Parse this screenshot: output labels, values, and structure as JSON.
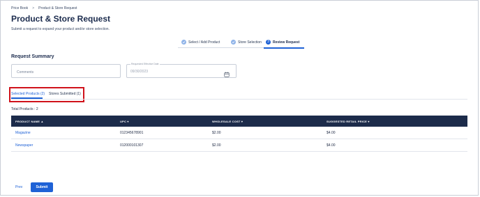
{
  "breadcrumb": {
    "items": [
      "Price Book",
      "Product & Store Request"
    ],
    "separator": ">"
  },
  "page": {
    "title": "Product & Store Request",
    "subtitle": "Submit a request to expand your product and/or store selection."
  },
  "stepper": {
    "steps": [
      {
        "label": "Select / Add Product",
        "state": "done",
        "marker": ""
      },
      {
        "label": "Store Selection",
        "state": "done",
        "marker": ""
      },
      {
        "label": "Review Request",
        "state": "active",
        "marker": "3"
      }
    ]
  },
  "request_summary": {
    "title": "Request Summary",
    "comments_placeholder": "Comments",
    "date_label": "Requested Effective Date",
    "date_value": "09/30/2023"
  },
  "tabs": [
    {
      "label": "Selected Products (2)",
      "selected": true
    },
    {
      "label": "Stores Submitted (1)",
      "selected": false
    }
  ],
  "total_products": "Total Products : 2",
  "table": {
    "columns": [
      "PRODUCT NAME ▲",
      "UPC ▾",
      "WHOLESALE COST ▾",
      "SUGGESTED RETAIL PRICE ▾"
    ],
    "rows": [
      [
        "Magazine",
        "012345678901",
        "$2.00",
        "$4.00"
      ],
      [
        "Newspaper",
        "012000101307",
        "$2.00",
        "$4.00"
      ]
    ]
  },
  "footer": {
    "prev_label": "Prev",
    "submit_label": "Submit"
  },
  "colors": {
    "accent": "#1f62d6",
    "header_bg": "#1c2b4a",
    "highlight": "#d0121b"
  },
  "icons": {
    "step_done": "check-circle-icon",
    "calendar": "calendar-icon"
  }
}
